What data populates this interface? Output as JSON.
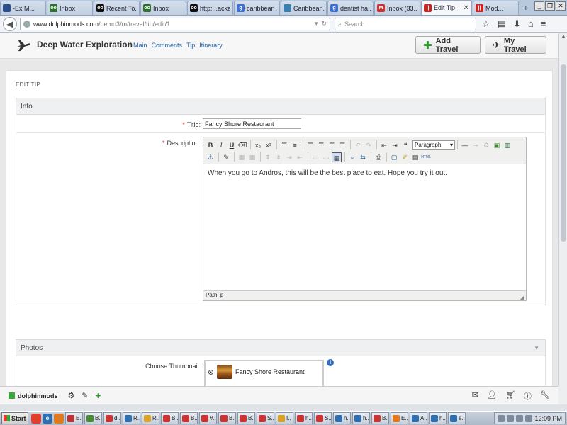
{
  "browser": {
    "tabs": [
      {
        "label": "-Ex M...",
        "fav": "#2c4d8a",
        "fav_text": "",
        "active": false
      },
      {
        "label": "Inbox",
        "fav": "#2d6f2d",
        "fav_text": "oo",
        "active": false
      },
      {
        "label": "Recent To...",
        "fav": "#111",
        "fav_text": "oo",
        "active": false
      },
      {
        "label": "Inbox",
        "fav": "#2d6f2d",
        "fav_text": "oo",
        "active": false
      },
      {
        "label": "http:...acker",
        "fav": "#111",
        "fav_text": "oo",
        "active": false
      },
      {
        "label": "caribbean ...",
        "fav": "#3b6fd3",
        "fav_text": "g",
        "active": false
      },
      {
        "label": "Caribbean...",
        "fav": "#3a7fb0",
        "fav_text": "",
        "active": false
      },
      {
        "label": "dentist ha...",
        "fav": "#3b6fd3",
        "fav_text": "g",
        "active": false
      },
      {
        "label": "Inbox (33...",
        "fav": "#c33",
        "fav_text": "M",
        "active": false
      },
      {
        "label": "Edit Tip",
        "fav": "#c22",
        "fav_text": "||",
        "active": true
      },
      {
        "label": "Mod...",
        "fav": "#c22",
        "fav_text": "||",
        "active": false
      }
    ],
    "url_domain": "www.dolphinmods.com",
    "url_path": "/demo3/m/travel/tip/edit/1",
    "search_placeholder": "Search"
  },
  "site": {
    "brand": "Deep Water Exploration",
    "nav": [
      "Main",
      "Comments",
      "Tip",
      "Itinerary"
    ],
    "add_travel": "Add Travel",
    "my_travel": "My Travel"
  },
  "page": {
    "title": "EDIT TIP",
    "info_section": "Info",
    "title_label": "Title:",
    "title_value": "Fancy Shore Restaurant",
    "description_label": "Description:",
    "format_select": "Paragraph",
    "description_text": "When you go to Andros, this will be the best place to eat. Hope you try it out.",
    "editor_path": "Path: p",
    "photos_section": "Photos",
    "thumbnail_label": "Choose Thumbnail:",
    "thumbnail_option": "Fancy Shore Restaurant"
  },
  "dolphin_bar": {
    "name": "dolphinmods"
  },
  "taskbar": {
    "start": "Start",
    "clock": "12:09 PM",
    "items": [
      {
        "label": "E..",
        "color": "#b33"
      },
      {
        "label": "B..",
        "color": "#4a8a3a"
      },
      {
        "label": "d..",
        "color": "#c33"
      },
      {
        "label": "R..",
        "color": "#2f6fb0"
      },
      {
        "label": "R..",
        "color": "#d9a22a"
      },
      {
        "label": "B..",
        "color": "#c33"
      },
      {
        "label": "B..",
        "color": "#c33"
      },
      {
        "label": "#..",
        "color": "#c33"
      },
      {
        "label": "B..",
        "color": "#c33"
      },
      {
        "label": "B..",
        "color": "#c33"
      },
      {
        "label": "S..",
        "color": "#c33"
      },
      {
        "label": "I..",
        "color": "#d9a22a"
      },
      {
        "label": "h..",
        "color": "#c33"
      },
      {
        "label": "S..",
        "color": "#c33"
      },
      {
        "label": "h..",
        "color": "#2f6fb0"
      },
      {
        "label": "h..",
        "color": "#2f6fb0"
      },
      {
        "label": "B..",
        "color": "#c33"
      },
      {
        "label": "E..",
        "color": "#e07a20"
      },
      {
        "label": "A..",
        "color": "#2f6fb0"
      },
      {
        "label": "h..",
        "color": "#2f6fb0"
      },
      {
        "label": "e..",
        "color": "#2f6fb0"
      }
    ]
  }
}
